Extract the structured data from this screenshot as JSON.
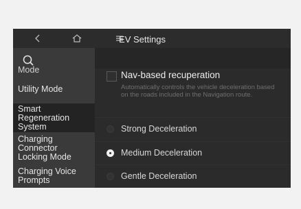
{
  "topbar": {
    "back_icon": "chevron-left-icon",
    "home_icon": "home-icon",
    "menu_icon": "menu-icon"
  },
  "header": {
    "title": "EV Settings"
  },
  "sidebar": {
    "search_icon": "search-icon",
    "items": [
      {
        "label": "Mode"
      },
      {
        "label": "Utility Mode"
      },
      {
        "label": "Smart Regeneration System"
      },
      {
        "label": "Charging Connector Locking Mode"
      },
      {
        "label": "Charging Voice Prompts"
      }
    ]
  },
  "panel": {
    "nav_option": {
      "title": "Nav-based recuperation",
      "description": "Automatically controls the vehicle deceleration based on the roads included in the Navigation route.",
      "checked": false
    },
    "radios": [
      {
        "label": "Strong Deceleration",
        "selected": false
      },
      {
        "label": "Medium Deceleration",
        "selected": true
      },
      {
        "label": "Gentle Deceleration",
        "selected": false
      }
    ]
  },
  "colors": {
    "frame_bg": "#2a2a2a",
    "sidebar_bg": "#3a3a3a",
    "active_item_bg": "#232323",
    "text_primary": "#e8e8e8",
    "text_muted": "#6f6f6f"
  }
}
